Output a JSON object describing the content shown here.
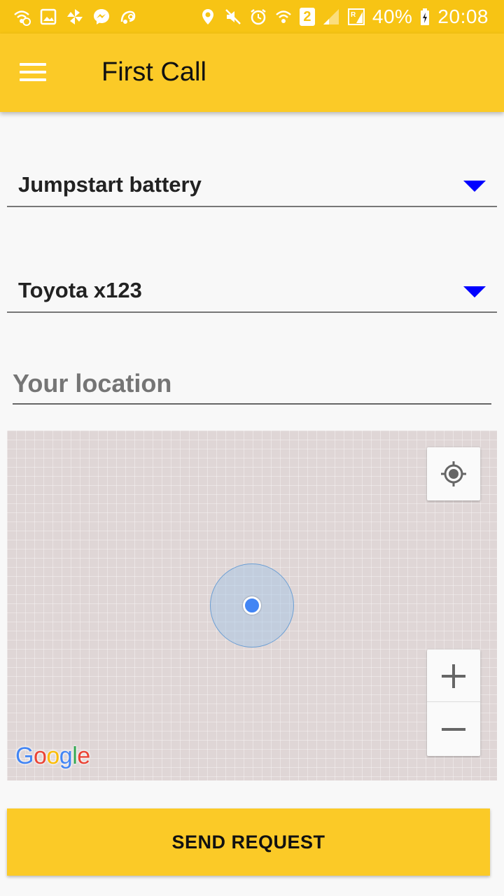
{
  "status_bar": {
    "left_icons": [
      "wifi-call-icon",
      "image-icon",
      "pinwheel-icon",
      "messenger-icon",
      "uc-browser-icon"
    ],
    "right_icons": [
      "location-icon",
      "mute-icon",
      "alarm-icon",
      "wifi-call-icon",
      "sim2-icon",
      "signal-icon",
      "signal-r-icon",
      "battery-charging-icon"
    ],
    "sim_label": "2",
    "battery_percent": "40%",
    "time": "20:08"
  },
  "app_bar": {
    "title": "First Call",
    "menu_icon": "menu-icon"
  },
  "form": {
    "service_type": "Jumpstart battery",
    "vehicle": "Toyota x123",
    "location_placeholder": "Your location",
    "location_value": ""
  },
  "map": {
    "provider_logo": "Google",
    "zoom_in_icon": "plus-icon",
    "zoom_out_icon": "minus-icon",
    "locate_icon": "my-location-icon"
  },
  "actions": {
    "send_label": "SEND REQUEST"
  },
  "colors": {
    "status_bar": "#f7c414",
    "app_bar": "#fbca27",
    "spinner_arrow": "#0000ff",
    "location_dot": "#4285f4"
  }
}
